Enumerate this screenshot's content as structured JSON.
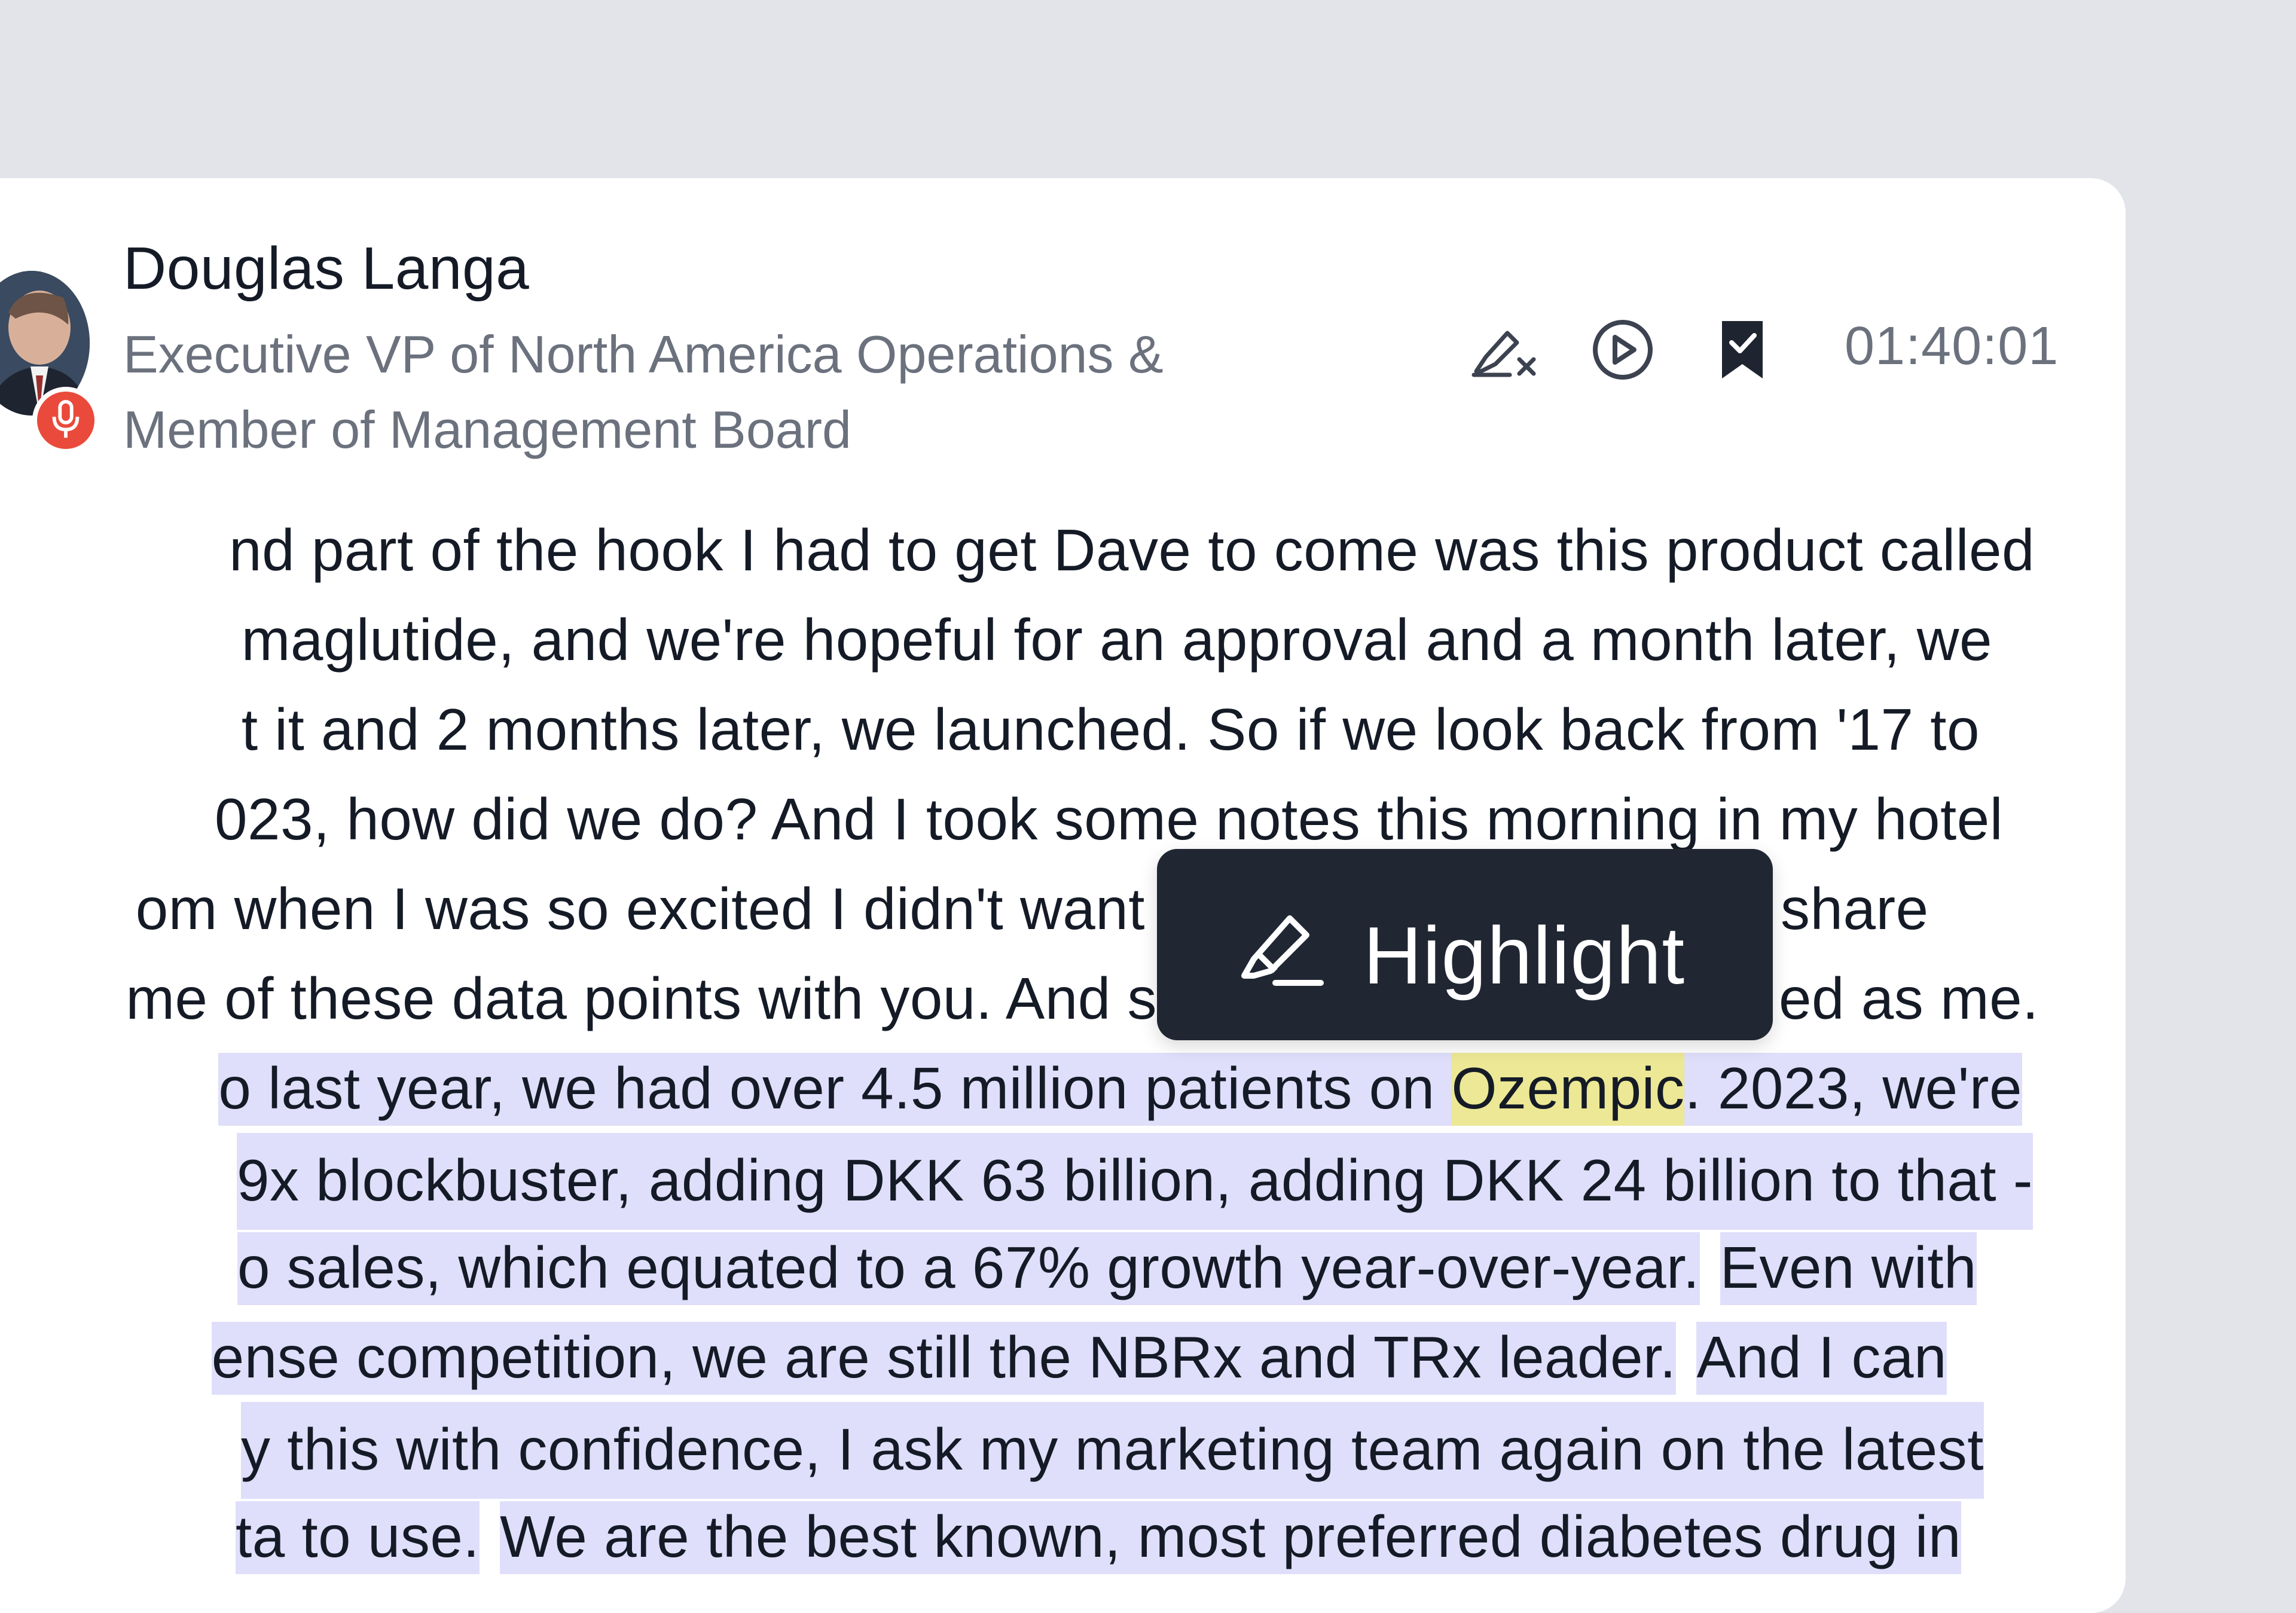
{
  "speaker": {
    "name": "Douglas Langa",
    "title_line1": "Executive VP of North America Operations &",
    "title_line2": "Member of Management Board",
    "timestamp": "01:40:01"
  },
  "toolbar": {
    "icons": [
      "remove-highlight-icon",
      "play-icon",
      "bookmark-check-icon"
    ]
  },
  "transcript": {
    "lines": [
      "nd part of the hook I had to get Dave to come was this product called",
      "maglutide, and we're hopeful for an approval and a month later, we",
      "t it and 2 months later, we launched. So if we look back from '17 to",
      "023, how did we do? And I took some notes this morning in my hotel",
      "om when I was so excited I didn't want",
      "share",
      "me of these data points with you. And s",
      "ed as me."
    ],
    "selected": {
      "l1_before": "o last year, we had over 4.5 million patients on ",
      "l1_highlight": "Ozempic",
      "l1_after": ". 2023, we're",
      "l2": "9x blockbuster, adding DKK 63 billion, adding DKK 24 billion to that -",
      "l3a": "o sales, which equated to a 67% growth year-over-year.",
      "l3b": "Even with",
      "l4a": "ense competition, we are still the NBRx and TRx leader.",
      "l4b": "And I can",
      "l5": "y this with confidence, I ask my marketing team again on the latest",
      "l6a": "ta to use.",
      "l6b": "We are the best known, most preferred diabetes drug in"
    }
  },
  "popup": {
    "label": "Highlight",
    "icon": "highlighter-icon"
  }
}
